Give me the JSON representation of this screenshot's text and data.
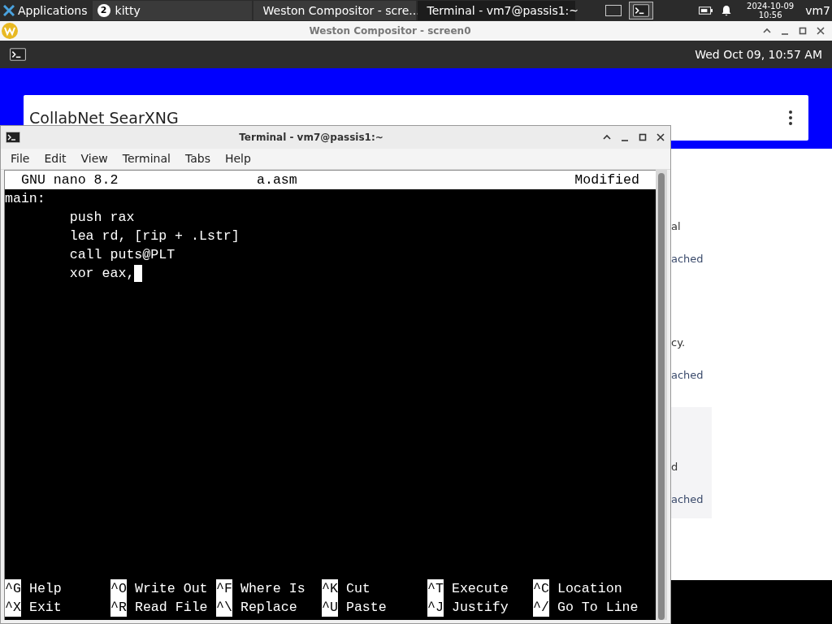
{
  "taskbar": {
    "apps_menu": "Applications",
    "tasks": [
      {
        "label": "kitty",
        "badge": "2",
        "selected": false
      },
      {
        "label": "Weston Compositor - scre...",
        "selected": false
      },
      {
        "label": "Terminal - vm7@passis1:~",
        "selected": true
      }
    ],
    "workspaces": [
      {
        "selected": false
      },
      {
        "selected": true
      }
    ],
    "date": "2024-10-09",
    "time": "10:56",
    "user": "vm7"
  },
  "weston": {
    "title": "Weston Compositor - screen0",
    "clock": "Wed Oct 09, 10:57 AM",
    "browser": {
      "title": "CollabNet SearXNG",
      "results": [
        {
          "text": "al",
          "link": "ached",
          "shaded": false
        },
        {
          "text": "cy.",
          "link": "ached",
          "shaded": false
        },
        {
          "text": "d",
          "link": "ached",
          "shaded": true
        }
      ]
    }
  },
  "terminal": {
    "title": "Terminal - vm7@passis1:~",
    "menu": [
      "File",
      "Edit",
      "View",
      "Terminal",
      "Tabs",
      "Help"
    ],
    "nano": {
      "version": "GNU nano 8.2",
      "file": "a.asm",
      "status": "Modified",
      "lines": [
        {
          "text": "main:",
          "cursor": false
        },
        {
          "text": "\tpush rax",
          "cursor": false
        },
        {
          "text": "\tlea rd, [rip + .Lstr]",
          "cursor": false
        },
        {
          "text": "\tcall puts@PLT",
          "cursor": false
        },
        {
          "text": "\txor eax,",
          "cursor": true
        }
      ],
      "shortcuts": [
        [
          {
            "key": "^G",
            "label": "Help"
          },
          {
            "key": "^O",
            "label": "Write Out"
          },
          {
            "key": "^F",
            "label": "Where Is"
          },
          {
            "key": "^K",
            "label": "Cut"
          },
          {
            "key": "^T",
            "label": "Execute"
          },
          {
            "key": "^C",
            "label": "Location"
          }
        ],
        [
          {
            "key": "^X",
            "label": "Exit"
          },
          {
            "key": "^R",
            "label": "Read File"
          },
          {
            "key": "^\\",
            "label": "Replace"
          },
          {
            "key": "^U",
            "label": "Paste"
          },
          {
            "key": "^J",
            "label": "Justify"
          },
          {
            "key": "^/",
            "label": "Go To Line"
          }
        ]
      ]
    }
  }
}
